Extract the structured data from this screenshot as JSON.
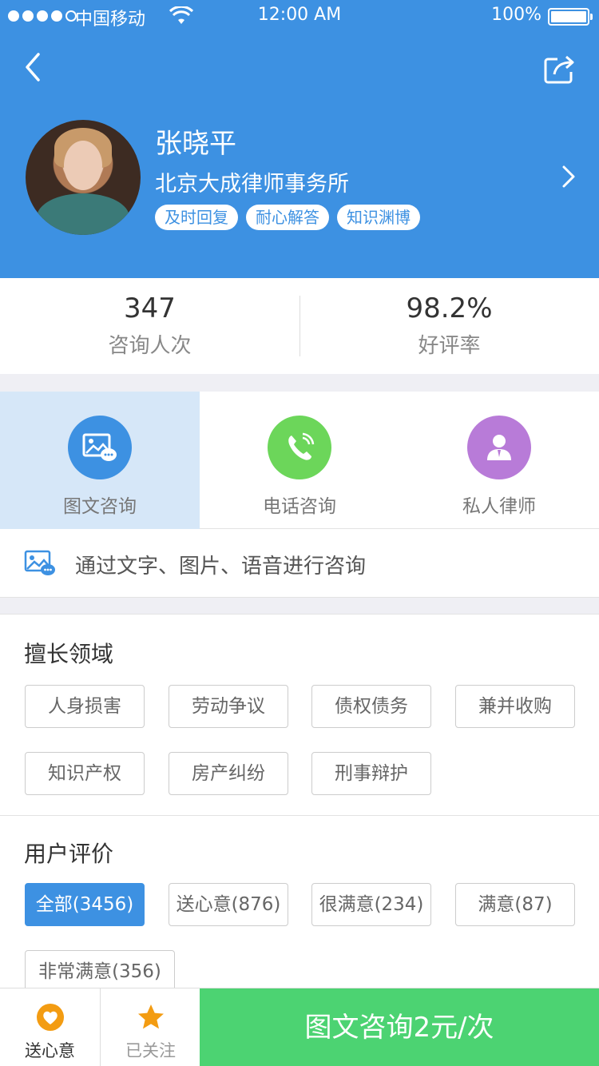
{
  "status_bar": {
    "carrier": "中国移动",
    "time": "12:00 AM",
    "battery": "100%"
  },
  "profile": {
    "name": "张晓平",
    "firm": "北京大成律师事务所",
    "tags": [
      "及时回复",
      "耐心解答",
      "知识渊博"
    ]
  },
  "stats": [
    {
      "value": "347",
      "label": "咨询人次"
    },
    {
      "value": "98.2%",
      "label": "好评率"
    }
  ],
  "consult_types": [
    {
      "label": "图文咨询",
      "color": "#3d91e2",
      "icon": "image-chat-icon"
    },
    {
      "label": "电话咨询",
      "color": "#6cd65a",
      "icon": "phone-icon"
    },
    {
      "label": "私人律师",
      "color": "#b87bd8",
      "icon": "lawyer-icon"
    }
  ],
  "description": "通过文字、图片、语音进行咨询",
  "expertise": {
    "title": "擅长领域",
    "items": [
      "人身损害",
      "劳动争议",
      "债权债务",
      "兼并收购",
      "知识产权",
      "房产纠纷",
      "刑事辩护"
    ]
  },
  "reviews": {
    "title": "用户评价",
    "filters": [
      "全部(3456)",
      "送心意(876)",
      "很满意(234)",
      "满意(87)",
      "非常满意(356)"
    ]
  },
  "bottom_bar": {
    "gift_label": "送心意",
    "follow_label": "已关注",
    "cta_label": "图文咨询2元/次"
  },
  "colors": {
    "primary": "#3d91e2",
    "green": "#4cd372",
    "orange": "#f39c12"
  }
}
